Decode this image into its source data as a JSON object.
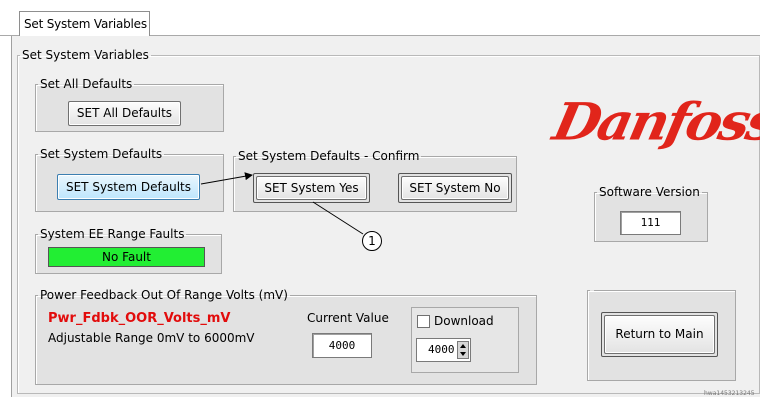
{
  "tab": {
    "label": "Set System Variables"
  },
  "main_group": {
    "title": "Set System Variables"
  },
  "set_all_defaults": {
    "title": "Set All Defaults",
    "button": "SET All Defaults"
  },
  "set_system_defaults": {
    "title": "Set System Defaults",
    "button": "SET System Defaults"
  },
  "confirm": {
    "title": "Set System Defaults - Confirm",
    "yes_button": "SET System Yes",
    "no_button": "SET System No"
  },
  "ee_faults": {
    "title": "System EE Range Faults",
    "status": "No Fault",
    "status_color": "#22ee33"
  },
  "logo": {
    "text": "Danfoss",
    "color": "#e1251b"
  },
  "software_version": {
    "title": "Software Version",
    "value": "111"
  },
  "power_feedback": {
    "title": "Power Feedback Out Of Range Volts (mV)",
    "variable": "Pwr_Fdbk_OOR_Volts_mV",
    "range": "Adjustable Range 0mV to 6000mV",
    "current_value_label": "Current Value",
    "current_value": "4000",
    "download_label": "Download",
    "download_checked": false,
    "download_value": "4000"
  },
  "return_main": {
    "button": "Return to Main"
  },
  "callout": {
    "number": "1"
  },
  "footer_id": "hwa1453213245"
}
